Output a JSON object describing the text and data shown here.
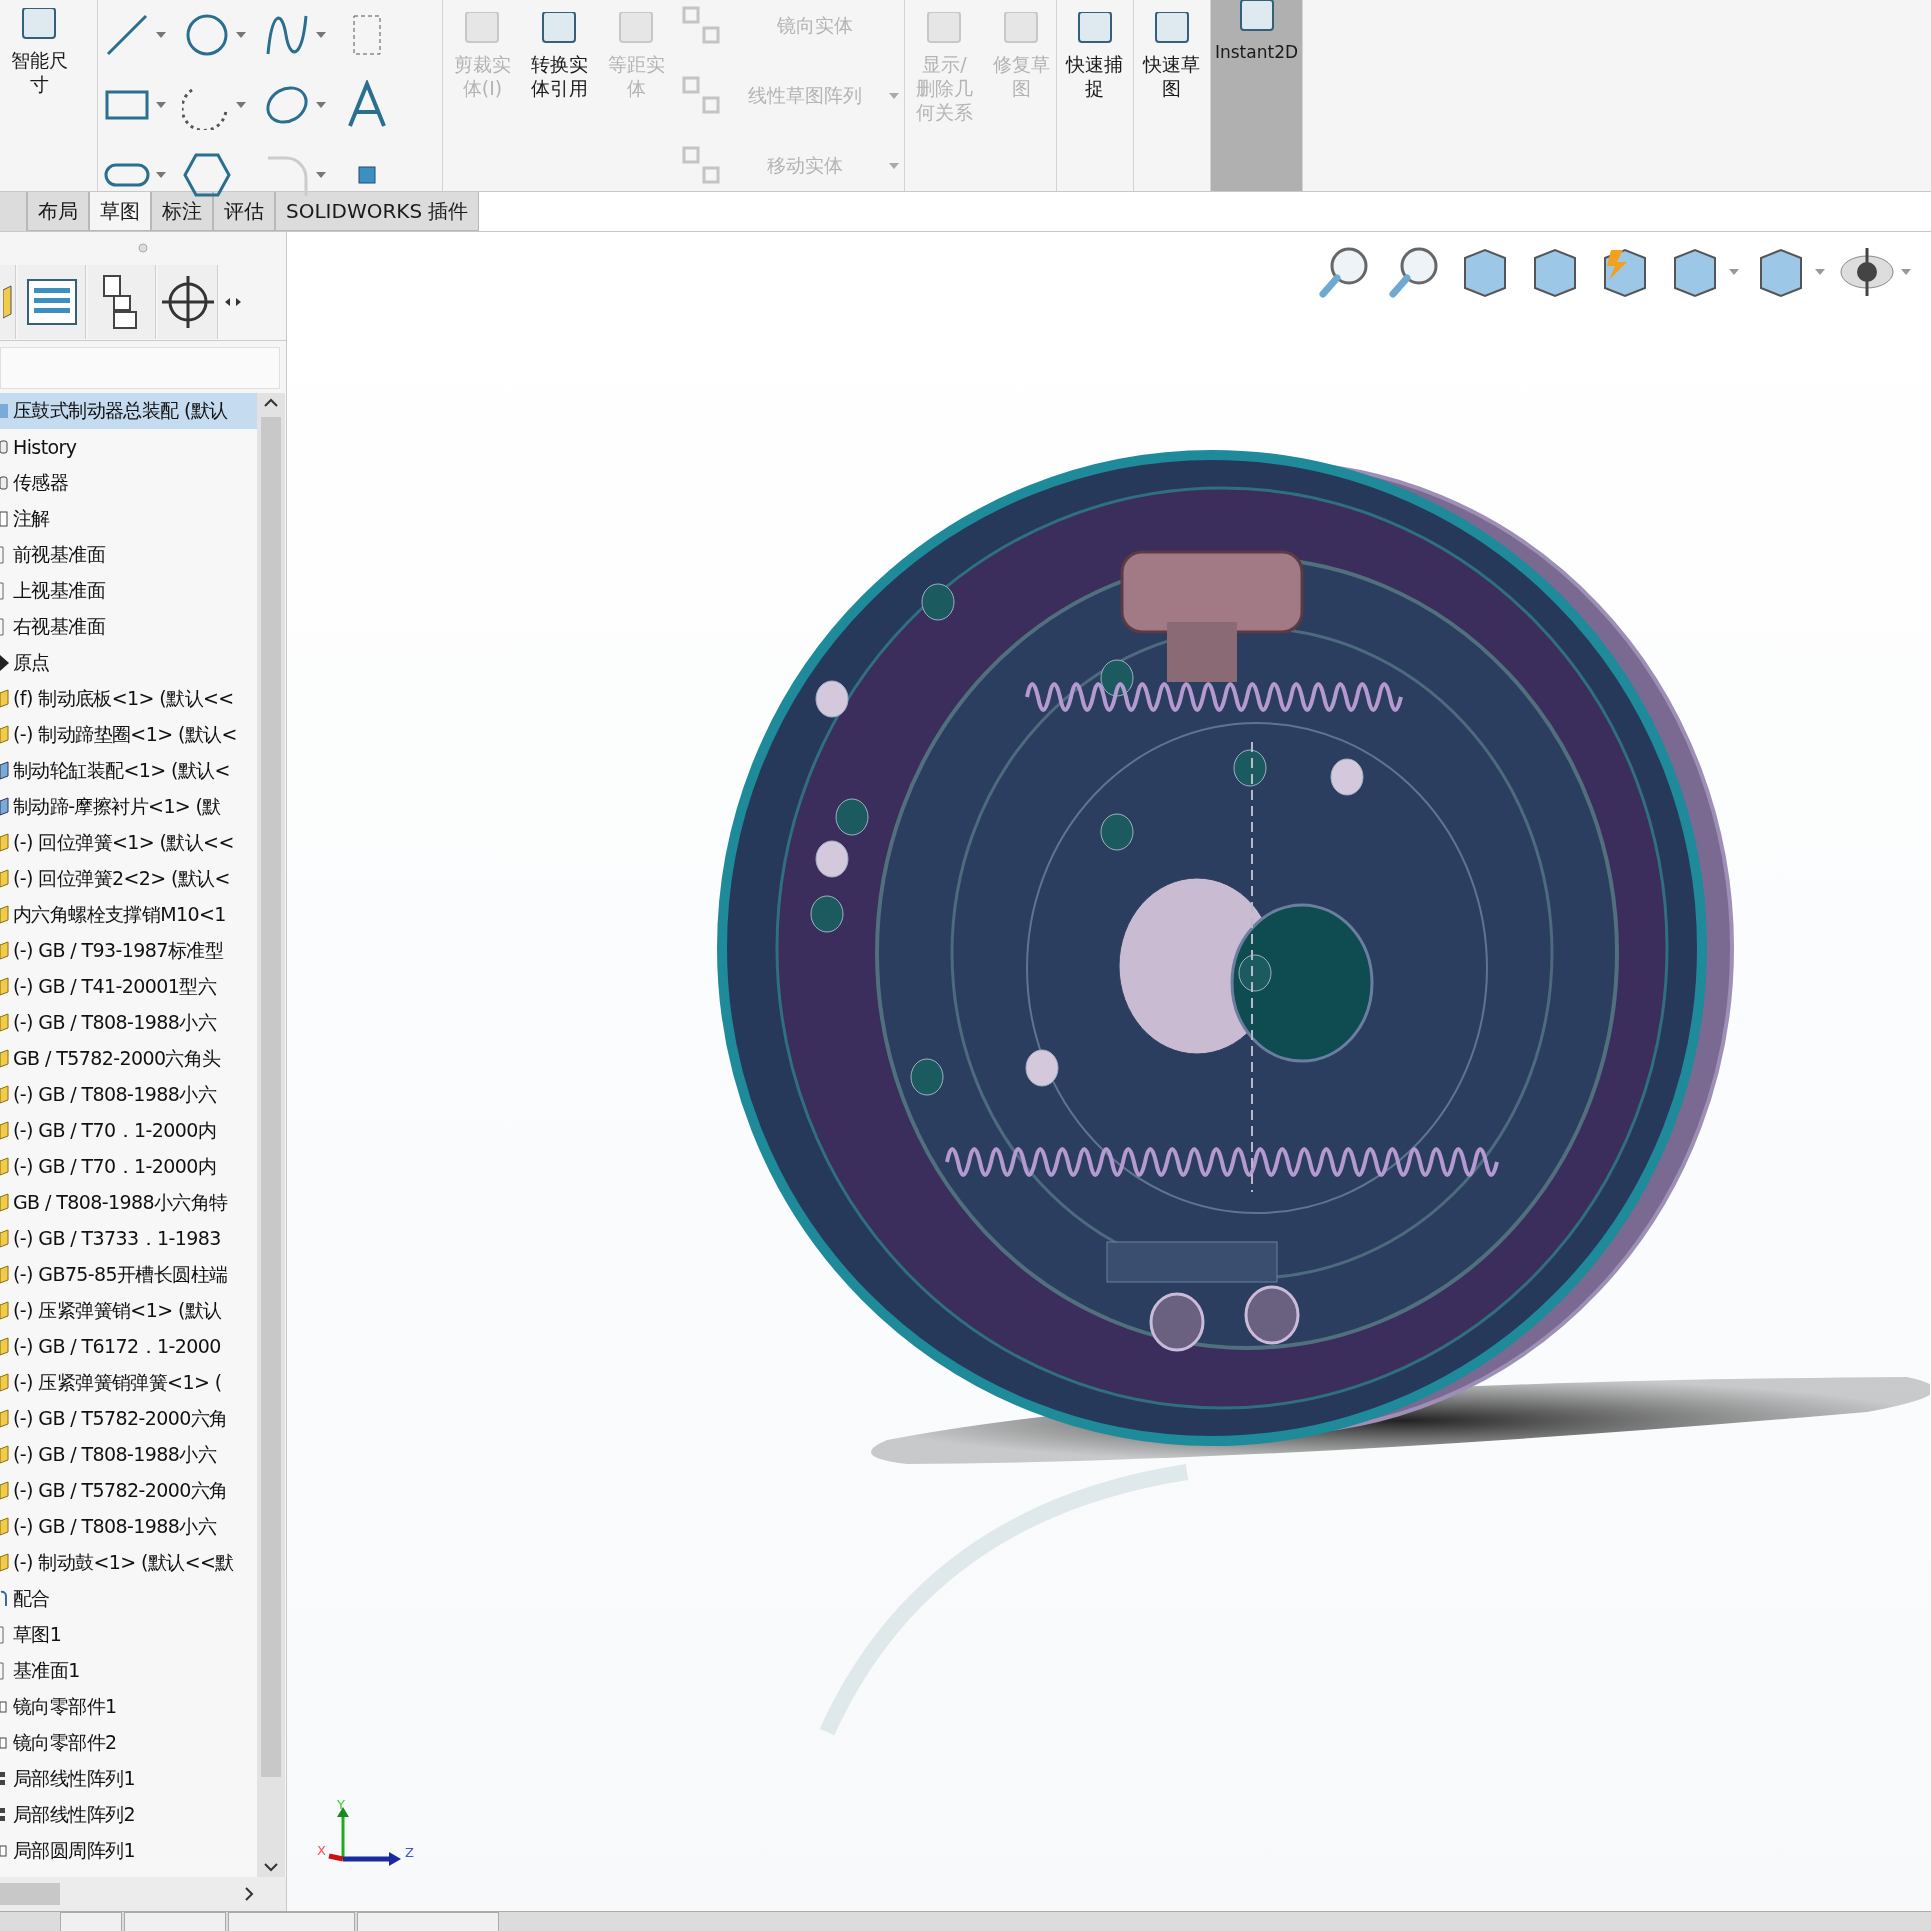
{
  "ribbon": {
    "smart_dimension": {
      "label": "智能尺寸"
    },
    "commands": [
      {
        "label": "剪裁实体(I)",
        "disabled": true
      },
      {
        "label": "转换实体引用",
        "disabled": false
      },
      {
        "label": "等距实体",
        "disabled": true
      }
    ],
    "entity_commands": [
      {
        "label": "镜向实体",
        "disabled": true,
        "dropdown": false
      },
      {
        "label": "线性草图阵列",
        "disabled": true,
        "dropdown": true
      },
      {
        "label": "移动实体",
        "disabled": true,
        "dropdown": true
      }
    ],
    "relation_commands": [
      {
        "label": "显示/删除几何关系",
        "disabled": true
      },
      {
        "label": "修复草图",
        "disabled": true
      }
    ],
    "snap_commands": [
      {
        "label": "快速捕捉",
        "kind": "command",
        "selected": false
      },
      {
        "label": "快速草图",
        "kind": "command",
        "selected": false
      },
      {
        "label": "Instant2D",
        "kind": "toggle",
        "selected": true
      }
    ]
  },
  "tabs": [
    {
      "label": "布局",
      "selected": false
    },
    {
      "label": "草图",
      "selected": true
    },
    {
      "label": "标注",
      "selected": false
    },
    {
      "label": "评估",
      "selected": false
    },
    {
      "label": "SOLIDWORKS 插件",
      "selected": false
    }
  ],
  "tree": {
    "items": [
      {
        "label": "压鼓式制动器总装配 (默认",
        "kind": "assembly",
        "selected": true
      },
      {
        "label": "History",
        "kind": "history",
        "selected": false
      },
      {
        "label": "传感器",
        "kind": "sensor",
        "selected": false
      },
      {
        "label": "注解",
        "kind": "annotation",
        "selected": false
      },
      {
        "label": "前视基准面",
        "kind": "plane",
        "selected": false
      },
      {
        "label": "上视基准面",
        "kind": "plane",
        "selected": false
      },
      {
        "label": "右视基准面",
        "kind": "plane",
        "selected": false
      },
      {
        "label": "原点",
        "kind": "origin",
        "selected": false
      },
      {
        "label": "(f) 制动底板<1> (默认<<",
        "kind": "part",
        "selected": false
      },
      {
        "label": "(-) 制动蹄垫圈<1> (默认<",
        "kind": "part",
        "selected": false
      },
      {
        "label": "制动轮缸装配<1> (默认<",
        "kind": "subassembly",
        "selected": false
      },
      {
        "label": "制动蹄-摩擦衬片<1> (默",
        "kind": "subassembly",
        "selected": false
      },
      {
        "label": "(-) 回位弹簧<1> (默认<<",
        "kind": "part",
        "selected": false
      },
      {
        "label": "(-) 回位弹簧2<2> (默认<",
        "kind": "part",
        "selected": false
      },
      {
        "label": "内六角螺栓支撑销M10<1",
        "kind": "part",
        "selected": false
      },
      {
        "label": "(-) GB / T93-1987标准型",
        "kind": "part",
        "selected": false
      },
      {
        "label": "(-) GB / T41-20001型六",
        "kind": "part",
        "selected": false
      },
      {
        "label": "(-) GB / T808-1988小六",
        "kind": "part",
        "selected": false
      },
      {
        "label": "GB / T5782-2000六角头",
        "kind": "part",
        "selected": false
      },
      {
        "label": "(-) GB / T808-1988小六",
        "kind": "part",
        "selected": false
      },
      {
        "label": "(-) GB / T70．1-2000内",
        "kind": "part",
        "selected": false
      },
      {
        "label": "(-) GB / T70．1-2000内",
        "kind": "part",
        "selected": false
      },
      {
        "label": "GB / T808-1988小六角特",
        "kind": "part",
        "selected": false
      },
      {
        "label": "(-) GB / T3733．1-1983",
        "kind": "part",
        "selected": false
      },
      {
        "label": "(-) GB75-85开槽长圆柱端",
        "kind": "part",
        "selected": false
      },
      {
        "label": "(-) 压紧弹簧销<1> (默认",
        "kind": "part",
        "selected": false
      },
      {
        "label": "(-) GB / T6172．1-2000",
        "kind": "part",
        "selected": false
      },
      {
        "label": "(-) 压紧弹簧销弹簧<1> (",
        "kind": "part",
        "selected": false
      },
      {
        "label": "(-) GB / T5782-2000六角",
        "kind": "part",
        "selected": false
      },
      {
        "label": "(-) GB / T808-1988小六",
        "kind": "part",
        "selected": false
      },
      {
        "label": "(-) GB / T5782-2000六角",
        "kind": "part",
        "selected": false
      },
      {
        "label": "(-) GB / T808-1988小六",
        "kind": "part",
        "selected": false
      },
      {
        "label": "(-) 制动鼓<1> (默认<<默",
        "kind": "part",
        "selected": false
      },
      {
        "label": "配合",
        "kind": "mate",
        "selected": false
      },
      {
        "label": "草图1",
        "kind": "sketch",
        "selected": false
      },
      {
        "label": "基准面1",
        "kind": "plane",
        "selected": false
      },
      {
        "label": "镜向零部件1",
        "kind": "mirror",
        "selected": false
      },
      {
        "label": "镜向零部件2",
        "kind": "mirror",
        "selected": false
      },
      {
        "label": "局部线性阵列1",
        "kind": "pattern",
        "selected": false
      },
      {
        "label": "局部线性阵列2",
        "kind": "pattern",
        "selected": false
      },
      {
        "label": "局部圆周阵列1",
        "kind": "mirror",
        "selected": false
      }
    ]
  },
  "triad": {
    "x_label": "X",
    "y_label": "Y",
    "z_label": "Z"
  }
}
